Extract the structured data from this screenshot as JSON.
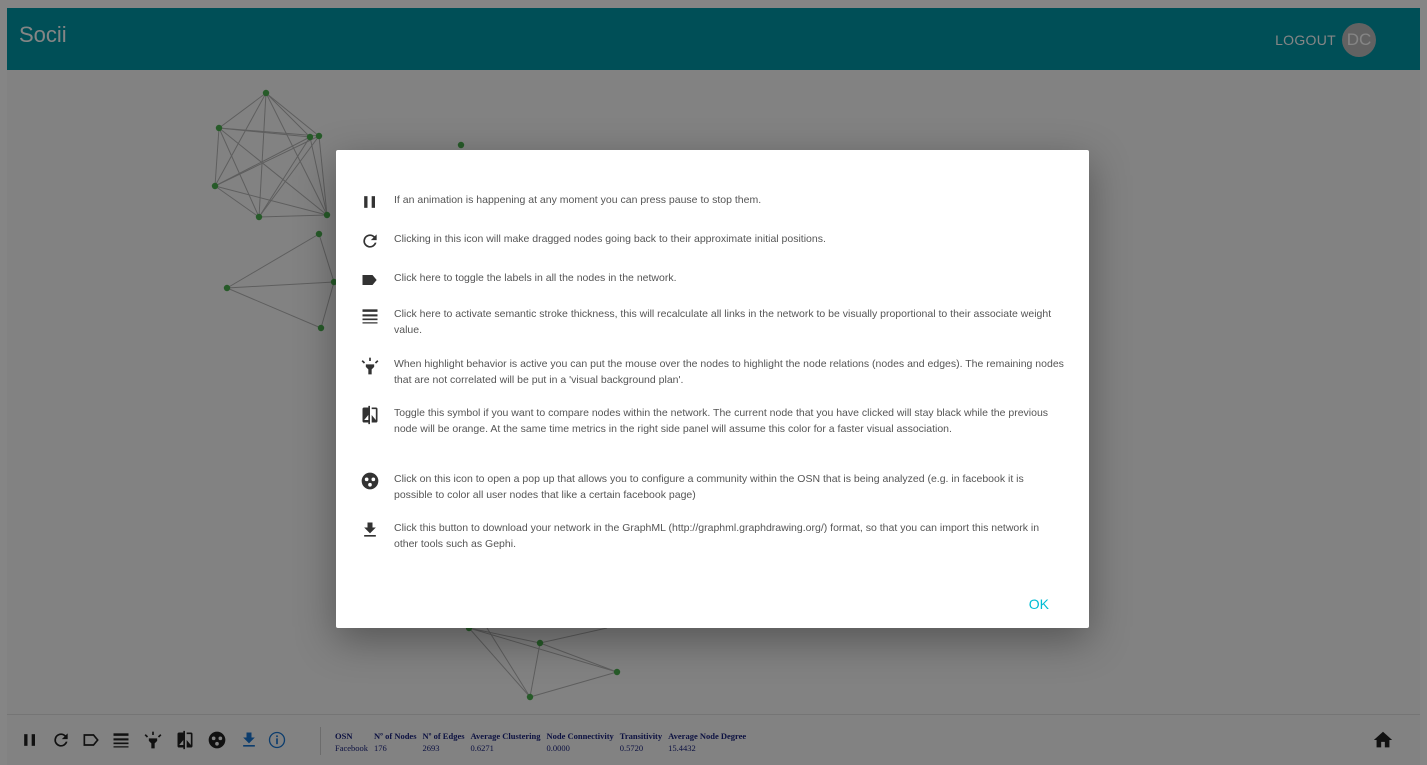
{
  "app": {
    "title": "Socii"
  },
  "header": {
    "logout_label": "LOGOUT",
    "avatar_initials": "DC"
  },
  "colors": {
    "primary": "#0097a7",
    "accent": "#00bcd4",
    "node": "#4caf50",
    "stats_text": "#1a237e"
  },
  "toolbar": {
    "buttons": [
      {
        "name": "pause-button",
        "icon": "pause-icon"
      },
      {
        "name": "reset-positions-button",
        "icon": "refresh-icon"
      },
      {
        "name": "toggle-labels-button",
        "icon": "label-outline-icon"
      },
      {
        "name": "stroke-thickness-button",
        "icon": "lines-icon"
      },
      {
        "name": "highlight-button",
        "icon": "highlight-icon"
      },
      {
        "name": "compare-button",
        "icon": "compare-icon"
      },
      {
        "name": "community-button",
        "icon": "community-icon"
      },
      {
        "name": "download-button",
        "icon": "download-icon"
      },
      {
        "name": "info-button",
        "icon": "info-icon"
      }
    ]
  },
  "stats": {
    "headers": [
      "OSN",
      "Nº of Nodes",
      "Nº of Edges",
      "Average Clustering",
      "Node Connectivity",
      "Transitivity",
      "Average Node Degree"
    ],
    "values": [
      "Facebook",
      "176",
      "2693",
      "0.6271",
      "0.0000",
      "0.5720",
      "15.4432"
    ]
  },
  "dialog": {
    "items": [
      {
        "icon": "pause-icon",
        "text": "If an animation is happening at any moment you can press pause to stop them."
      },
      {
        "icon": "refresh-icon",
        "text": "Clicking in this icon will make dragged nodes going back to their approximate initial positions."
      },
      {
        "icon": "label-icon",
        "text": "Click here to toggle the labels in all the nodes in the network."
      },
      {
        "icon": "lines-icon",
        "text": "Click here to activate semantic stroke thickness, this will recalculate all links in the network to be visually proportional to their associate weight value."
      },
      {
        "icon": "highlight-icon",
        "text": "When highlight behavior is active you can put the mouse over the nodes to highlight the node relations (nodes and edges). The remaining nodes that are not correlated will be put in a 'visual background plan'."
      },
      {
        "icon": "compare-icon",
        "text": "Toggle this symbol if you want to compare nodes within the network. The current node that you have clicked will stay black while the previous node will be orange. At the same time metrics in the right side panel will assume this color for a faster visual association."
      },
      {
        "icon": "community-icon",
        "text": "Click on this icon to open a pop up that allows you to configure a community within the OSN that is being analyzed (e.g. in facebook it is possible to color all user nodes that like a certain facebook page)"
      },
      {
        "icon": "download-icon",
        "text": "Click this button to download your network in the GraphML (http://graphml.graphdrawing.org/) format, so that you can import this network in other tools such as Gephi."
      }
    ],
    "ok_label": "OK"
  }
}
